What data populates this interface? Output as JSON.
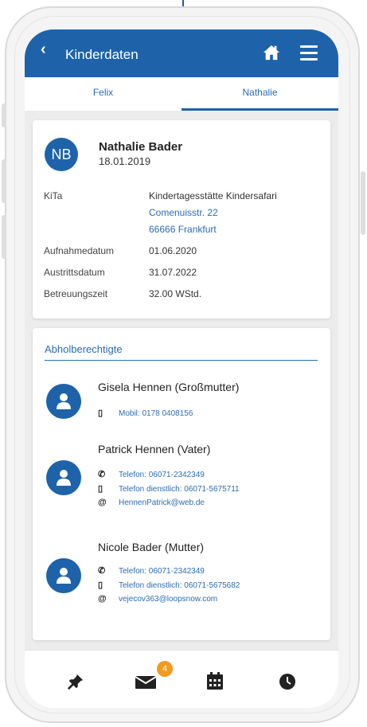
{
  "header": {
    "back_icon": "chevron-left-icon",
    "title": "Kinderdaten",
    "home_icon": "home-icon",
    "menu_icon": "menu-icon"
  },
  "tabs": [
    {
      "label": "Felix",
      "active": false
    },
    {
      "label": "Nathalie",
      "active": true
    }
  ],
  "child": {
    "initials": "NB",
    "name": "Nathalie Bader",
    "birthdate": "18.01.2019",
    "kita_label": "KiTa",
    "kita_name": "Kindertagesstätte Kindersafari",
    "kita_street": "Comenuisstr. 22",
    "kita_city": "66666 Frankfurt",
    "admission_label": "Aufnahmedatum",
    "admission_date": "01.06.2020",
    "exit_label": "Austrittsdatum",
    "exit_date": "31.07.2022",
    "care_label": "Betreuungszeit",
    "care_time": "32.00 WStd."
  },
  "pickup": {
    "title": "Abholberechtigte",
    "persons": [
      {
        "name": "Gisela Hennen (Großmutter)",
        "contacts": [
          {
            "icon": "mobile-icon",
            "text": "Mobil: 0178 0408156"
          }
        ]
      },
      {
        "name": "Patrick Hennen (Vater)",
        "contacts": [
          {
            "icon": "phone-icon",
            "text": "Telefon: 06071-2342349"
          },
          {
            "icon": "mobile-icon",
            "text": "Telefon dienstlich: 06071-5675711"
          },
          {
            "icon": "email-icon",
            "text": "HennenPatrick@web.de"
          }
        ]
      },
      {
        "name": "Nicole Bader (Mutter)",
        "contacts": [
          {
            "icon": "phone-icon",
            "text": "Telefon: 06071-2342349"
          },
          {
            "icon": "mobile-icon",
            "text": "Telefon dienstlich: 06071-5675682"
          },
          {
            "icon": "email-icon",
            "text": "vejecov363@loopsnow.com"
          }
        ]
      }
    ]
  },
  "bottom_nav": {
    "items": [
      "pin-icon",
      "mail-icon",
      "calendar-icon",
      "clock-icon"
    ],
    "mail_badge": "4"
  },
  "colors": {
    "primary": "#1e63aa",
    "badge": "#f29a1e"
  }
}
